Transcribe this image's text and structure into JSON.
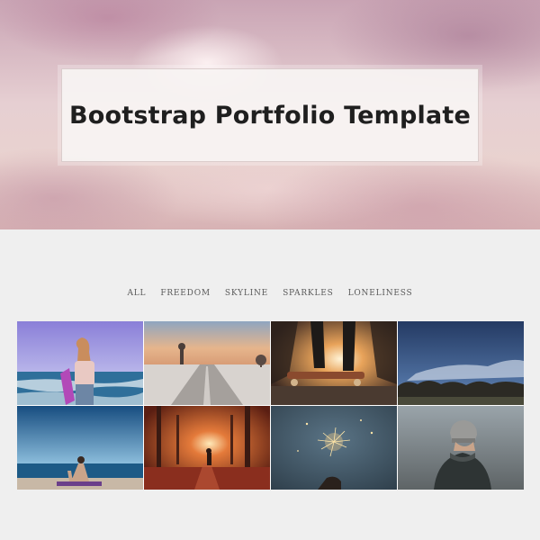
{
  "hero": {
    "title": "Bootstrap Portfolio Template"
  },
  "filters": [
    {
      "label": "ALL"
    },
    {
      "label": "FREEDOM"
    },
    {
      "label": "SKYLINE"
    },
    {
      "label": "SPARKLES"
    },
    {
      "label": "LONELINESS"
    }
  ],
  "gallery": {
    "tiles": [
      {
        "subject": "woman with surfboard at beach"
      },
      {
        "subject": "person skateboarding on road at sunset"
      },
      {
        "subject": "skateboarder legs against sunlight"
      },
      {
        "subject": "blue sky over treeline"
      },
      {
        "subject": "woman doing yoga by the sea"
      },
      {
        "subject": "person walking through autumn forest"
      },
      {
        "subject": "hand holding sparkler"
      },
      {
        "subject": "person in beanie and hoodie"
      }
    ]
  }
}
